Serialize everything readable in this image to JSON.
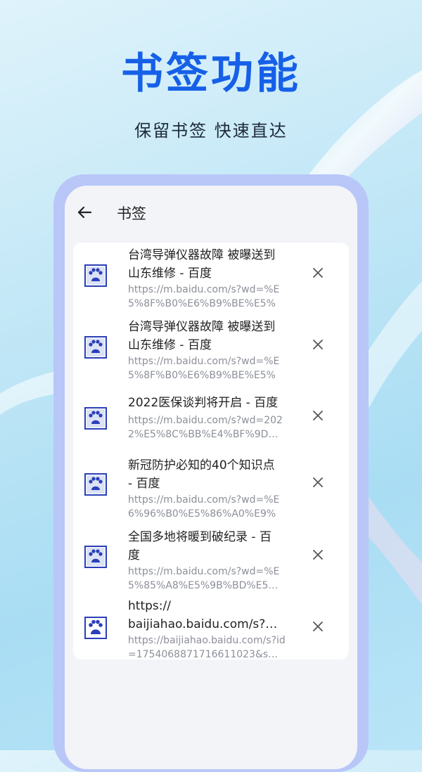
{
  "hero": {
    "title": "书签功能",
    "subtitle": "保留书签 快速直达"
  },
  "colors": {
    "accent": "#1660e8",
    "frame": "#b8c7f8",
    "screen_bg": "#f3f4f8",
    "icon_blue": "#2a3fb8"
  },
  "appbar": {
    "back_icon": "arrow-left-icon",
    "title": "书签"
  },
  "bookmarks": [
    {
      "icon": "baidu-paw-icon",
      "title": "台湾导弹仪器故障 被曝送到\n山东维修 - 百度",
      "url": "https://m.baidu.com/s?wd=%E5%8F%B0%E6%B9%BE%E5%A…",
      "close_icon": "close-icon"
    },
    {
      "icon": "baidu-paw-icon",
      "title": "台湾导弹仪器故障 被曝送到\n山东维修 - 百度",
      "url": "https://m.baidu.com/s?wd=%E5%8F%B0%E6%B9%BE%E5%A…",
      "close_icon": "close-icon"
    },
    {
      "icon": "baidu-paw-icon",
      "title": "2022医保谈判将开启 - 百度",
      "url": "https://m.baidu.com/s?wd=2022%E5%8C%BB%E4%BF%9D…",
      "close_icon": "close-icon"
    },
    {
      "icon": "baidu-paw-icon",
      "title": "新冠防护必知的40个知识点\n- 百度",
      "url": "https://m.baidu.com/s?wd=%E6%96%B0%E5%86%A0%E9%9…",
      "close_icon": "close-icon"
    },
    {
      "icon": "baidu-paw-icon",
      "title": "全国多地将暖到破纪录 - 百\n度",
      "url": "https://m.baidu.com/s?wd=%E5%85%A8%E5%9B%BD%E5…",
      "close_icon": "close-icon"
    },
    {
      "icon": "baidu-paw-icon",
      "title": "https://\nbaijiahao.baidu.com/s?…",
      "url": "https://baijiahao.baidu.com/s?id=1754068871716611023&s…",
      "close_icon": "close-icon"
    }
  ]
}
